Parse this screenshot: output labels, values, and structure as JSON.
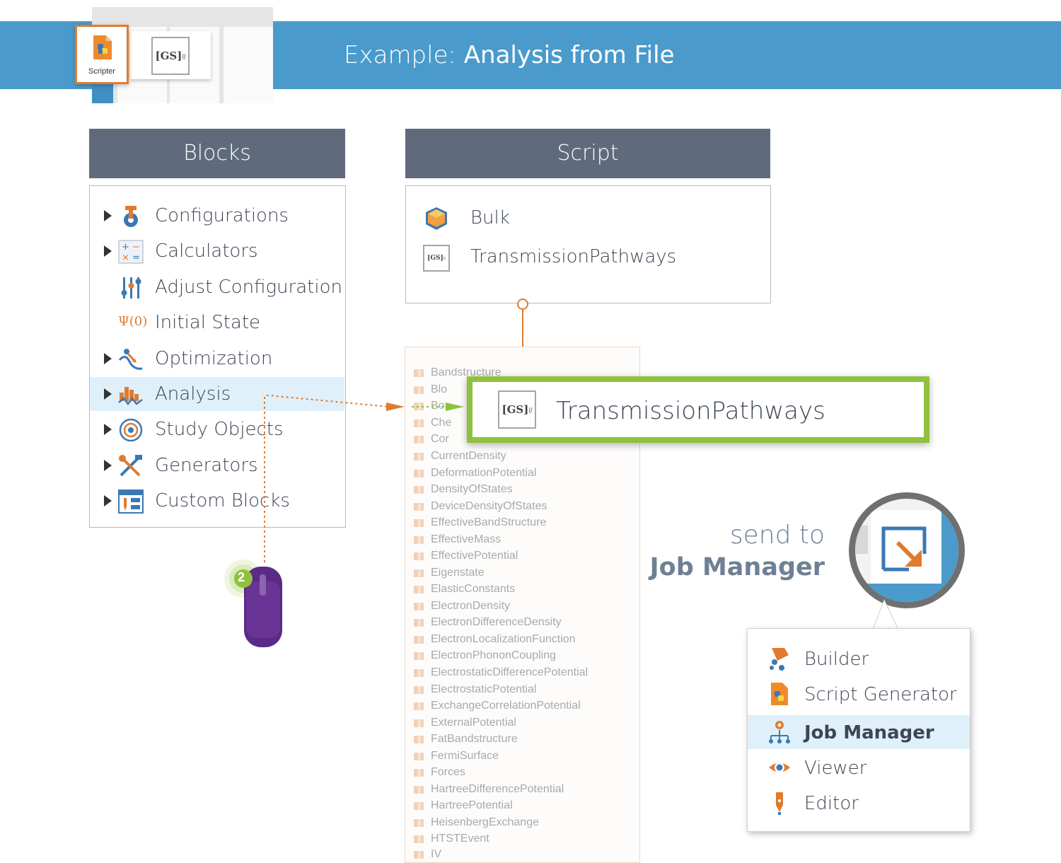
{
  "header": {
    "title_prefix": "Example: ",
    "title_main": "Analysis from File",
    "scripter_label": "Scripter",
    "gs_glyph": "[GS]",
    "gs_sub": "ij"
  },
  "blocks": {
    "title": "Blocks",
    "items": [
      {
        "label": "Configurations",
        "expandable": true,
        "icon": "configurations-icon"
      },
      {
        "label": "Calculators",
        "expandable": true,
        "icon": "calculators-icon"
      },
      {
        "label": "Adjust Configuration",
        "expandable": false,
        "icon": "adjust-configuration-icon"
      },
      {
        "label": "Initial State",
        "expandable": false,
        "icon": "initial-state-icon"
      },
      {
        "label": "Optimization",
        "expandable": true,
        "icon": "optimization-icon"
      },
      {
        "label": "Analysis",
        "expandable": true,
        "icon": "analysis-icon",
        "selected": true
      },
      {
        "label": "Study Objects",
        "expandable": true,
        "icon": "study-objects-icon"
      },
      {
        "label": "Generators",
        "expandable": true,
        "icon": "generators-icon"
      },
      {
        "label": "Custom Blocks",
        "expandable": true,
        "icon": "custom-blocks-icon"
      }
    ],
    "initial_state_glyph": "Ψ(0)"
  },
  "script": {
    "title": "Script",
    "items": [
      {
        "label": "Bulk",
        "icon": "bulk-icon"
      },
      {
        "label": "TransmissionPathways",
        "icon": "gs-icon"
      }
    ]
  },
  "analysis_list": {
    "items": [
      "Bandstructure",
      "Blo",
      "Bor",
      "Che",
      "Cor",
      "CurrentDensity",
      "DeformationPotential",
      "DensityOfStates",
      "DeviceDensityOfStates",
      "EffectiveBandStructure",
      "EffectiveMass",
      "EffectivePotential",
      "Eigenstate",
      "ElasticConstants",
      "ElectronDensity",
      "ElectronDifferenceDensity",
      "ElectronLocalizationFunction",
      "ElectronPhononCoupling",
      "ElectrostaticDifferencePotential",
      "ElectrostaticPotential",
      "ExchangeCorrelationPotential",
      "ExternalPotential",
      "FatBandstructure",
      "FermiSurface",
      "Forces",
      "HartreeDifferencePotential",
      "HartreePotential",
      "HeisenbergExchange",
      "HTSTEvent",
      "IV"
    ]
  },
  "dragged_item": {
    "label": "TransmissionPathways",
    "icon": "gs-icon"
  },
  "mouse": {
    "step": "2"
  },
  "send_to": {
    "line1": "send to",
    "line2": "Job Manager"
  },
  "menu": {
    "items": [
      {
        "label": "Builder",
        "icon": "builder-icon"
      },
      {
        "label": "Script Generator",
        "icon": "script-generator-icon"
      },
      {
        "label": "Job Manager",
        "icon": "job-manager-icon",
        "selected": true
      },
      {
        "label": "Viewer",
        "icon": "viewer-icon"
      },
      {
        "label": "Editor",
        "icon": "editor-icon"
      }
    ]
  },
  "colors": {
    "banner": "#4a9bcb",
    "panel_header": "#5f6b7d",
    "highlight_border": "#8fc13e",
    "accent_orange": "#e07b2e",
    "selection": "#dff0fa",
    "mouse": "#5b2a86"
  }
}
